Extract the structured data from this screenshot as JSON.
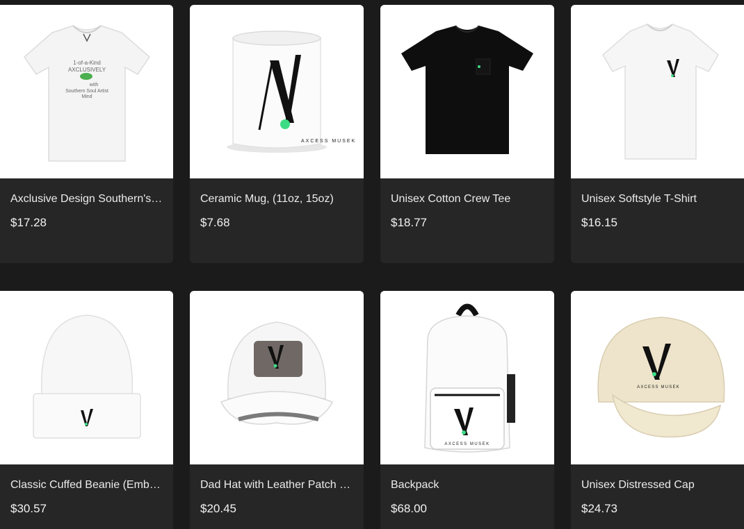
{
  "products": [
    {
      "title": "Axclusive Design Southern's Soul Artist Mind Tee",
      "price": "$17.28",
      "image_icon": "white-tshirt-graphic-icon"
    },
    {
      "title": "Ceramic Mug, (11oz, 15oz)",
      "price": "$7.68",
      "image_icon": "ceramic-mug-icon"
    },
    {
      "title": "Unisex Cotton Crew Tee",
      "price": "$18.77",
      "image_icon": "black-tshirt-icon"
    },
    {
      "title": "Unisex Softstyle T-Shirt",
      "price": "$16.15",
      "image_icon": "white-tshirt-logo-icon"
    },
    {
      "title": "Classic Cuffed Beanie (Embroidered)",
      "price": "$30.57",
      "image_icon": "white-beanie-icon"
    },
    {
      "title": "Dad Hat with Leather Patch (Rectangle)",
      "price": "$20.45",
      "image_icon": "dad-hat-icon"
    },
    {
      "title": "Backpack",
      "price": "$68.00",
      "image_icon": "backpack-icon"
    },
    {
      "title": "Unisex Distressed Cap",
      "price": "$24.73",
      "image_icon": "distressed-cap-icon"
    }
  ],
  "print_text": {
    "tee_line1": "1-of-a-Kind",
    "tee_line2": "AXCLUSIVELY",
    "tee_line3": "with",
    "tee_line4": "Southern Soul Artist",
    "tee_line5": "Mind",
    "brand": "AXCESS MUSEK"
  },
  "colors": {
    "page_bg": "#1b1b1b",
    "card_bg": "#262626",
    "accent_green": "#3ddc84",
    "cap_khaki": "#eee4cb"
  }
}
